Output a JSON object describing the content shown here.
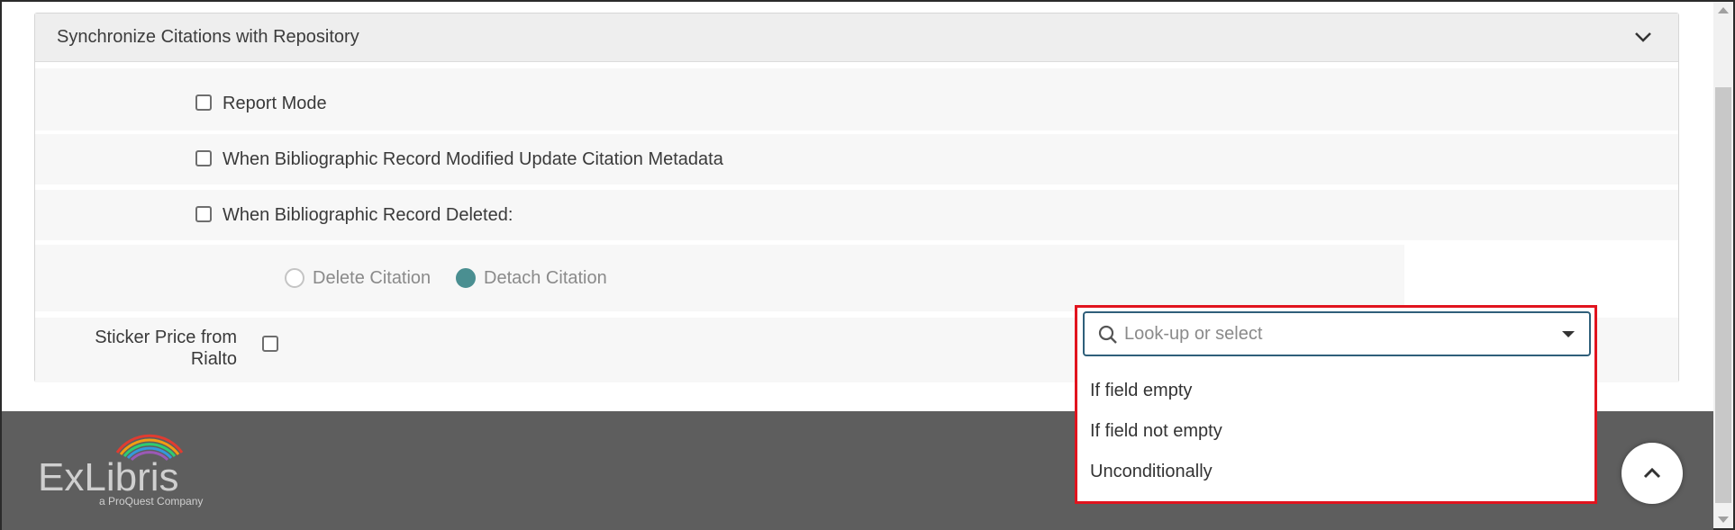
{
  "panel": {
    "title": "Synchronize Citations with Repository",
    "options": {
      "report_mode": "Report Mode",
      "modified_update": "When Bibliographic Record Modified Update Citation Metadata",
      "deleted": "When Bibliographic Record Deleted:"
    },
    "radio": {
      "delete_label": "Delete Citation",
      "detach_label": "Detach Citation",
      "selected": "Detach Citation"
    },
    "sticker_label": "Sticker Price from Rialto"
  },
  "dropdown": {
    "placeholder": "Look-up or select",
    "options": [
      "If field empty",
      "If field not empty",
      "Unconditionally"
    ]
  },
  "footer": {
    "logo_text": "ExLibris",
    "logo_sub": "a ProQuest Company"
  },
  "colors": {
    "accent": "#4a8f91",
    "highlight_border": "#e1141e",
    "footer_bg": "#5e5e5e"
  }
}
